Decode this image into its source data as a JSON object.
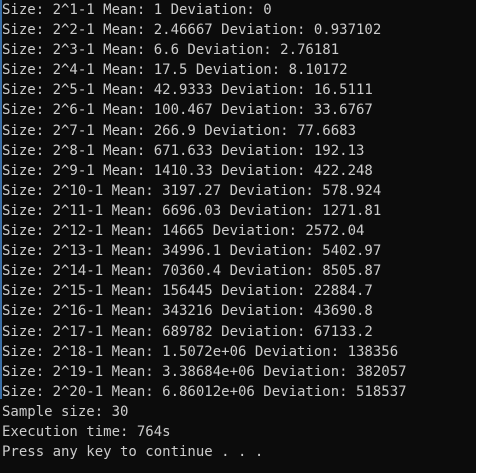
{
  "console": {
    "lines": [
      "Size: 2^1-1 Mean: 1 Deviation: 0",
      "Size: 2^2-1 Mean: 2.46667 Deviation: 0.937102",
      "Size: 2^3-1 Mean: 6.6 Deviation: 2.76181",
      "Size: 2^4-1 Mean: 17.5 Deviation: 8.10172",
      "Size: 2^5-1 Mean: 42.9333 Deviation: 16.5111",
      "Size: 2^6-1 Mean: 100.467 Deviation: 33.6767",
      "Size: 2^7-1 Mean: 266.9 Deviation: 77.6683",
      "Size: 2^8-1 Mean: 671.633 Deviation: 192.13",
      "Size: 2^9-1 Mean: 1410.33 Deviation: 422.248",
      "Size: 2^10-1 Mean: 3197.27 Deviation: 578.924",
      "Size: 2^11-1 Mean: 6696.03 Deviation: 1271.81",
      "Size: 2^12-1 Mean: 14665 Deviation: 2572.04",
      "Size: 2^13-1 Mean: 34996.1 Deviation: 5402.97",
      "Size: 2^14-1 Mean: 70360.4 Deviation: 8505.87",
      "Size: 2^15-1 Mean: 156445 Deviation: 22884.7",
      "Size: 2^16-1 Mean: 343216 Deviation: 43690.8",
      "Size: 2^17-1 Mean: 689782 Deviation: 67133.2",
      "Size: 2^18-1 Mean: 1.5072e+06 Deviation: 138356",
      "Size: 2^19-1 Mean: 3.38684e+06 Deviation: 382057",
      "Size: 2^20-1 Mean: 6.86012e+06 Deviation: 518537",
      "Sample size: 30",
      "Execution time: 764s",
      "Press any key to continue . . ."
    ],
    "colors": {
      "background": "#0c0c0c",
      "text": "#cccccc",
      "selection": "#3a6ea5"
    }
  }
}
